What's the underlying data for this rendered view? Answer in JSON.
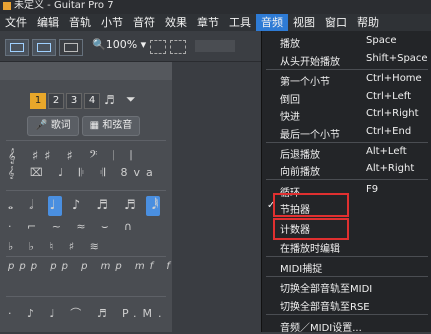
{
  "window": {
    "title": "未定义 - Guitar Pro 7"
  },
  "menubar": [
    {
      "label": "文件"
    },
    {
      "label": "编辑"
    },
    {
      "label": "音轨"
    },
    {
      "label": "小节"
    },
    {
      "label": "音符"
    },
    {
      "label": "效果"
    },
    {
      "label": "章节"
    },
    {
      "label": "工具"
    },
    {
      "label": "音频"
    },
    {
      "label": "视图"
    },
    {
      "label": "窗口"
    },
    {
      "label": "帮助"
    }
  ],
  "toolbar": {
    "zoom": "100%"
  },
  "left_panel": {
    "voices": [
      "1",
      "2",
      "3",
      "4"
    ],
    "lyrics_button": "歌词",
    "chord_button": "和弦音"
  },
  "audio_menu": {
    "items": [
      {
        "label": "播放",
        "shortcut": "Space"
      },
      {
        "label": "从头开始播放",
        "shortcut": "Shift+Space"
      },
      {
        "label": "第一个小节",
        "shortcut": "Ctrl+Home"
      },
      {
        "label": "倒回",
        "shortcut": "Ctrl+Left"
      },
      {
        "label": "快进",
        "shortcut": "Ctrl+Right"
      },
      {
        "label": "最后一个小节",
        "shortcut": "Ctrl+End"
      },
      {
        "label": "后退播放",
        "shortcut": "Alt+Left"
      },
      {
        "label": "向前播放",
        "shortcut": "Alt+Right"
      },
      {
        "label": "循环",
        "shortcut": "F9"
      },
      {
        "label": "节拍器",
        "shortcut": "",
        "checked": true
      },
      {
        "label": "计数器",
        "shortcut": ""
      },
      {
        "label": "在播放时编辑",
        "shortcut": ""
      },
      {
        "label": "MIDI捕捉",
        "shortcut": ""
      },
      {
        "label": "切换全部音轨至MIDI",
        "shortcut": ""
      },
      {
        "label": "切换全部音轨至RSE",
        "shortcut": ""
      },
      {
        "label": "音频／MIDI设置...",
        "shortcut": ""
      }
    ]
  },
  "colors": {
    "accent": "#2e7bd5",
    "highlight_box": "#e03030",
    "voice_selected": "#e8a72a"
  }
}
